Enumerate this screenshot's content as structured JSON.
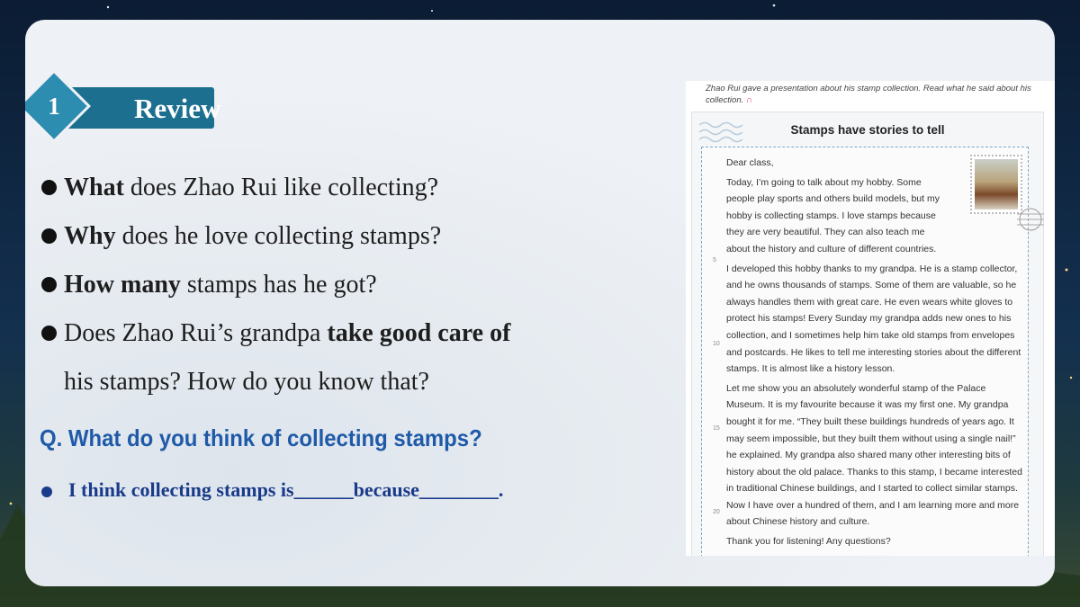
{
  "section": {
    "number": "1",
    "title": "Review"
  },
  "questions": [
    {
      "bold": "What",
      "rest": " does Zhao Rui like collecting?"
    },
    {
      "bold": "Why",
      "rest": " does he love collecting stamps?"
    },
    {
      "bold": "How many",
      "rest": " stamps has he got?"
    },
    {
      "pre": "Does Zhao Rui’s grandpa ",
      "bold": "take good care of",
      "cont": "his stamps? How do you know that?"
    }
  ],
  "discussion": {
    "question": "Q. What do you think of collecting stamps?",
    "prompt": "I think collecting stamps is______because________."
  },
  "textbook": {
    "intro": "Zhao Rui gave a presentation about his stamp collection. Read what he said about his collection.",
    "title": "Stamps have stories to tell",
    "greeting": "Dear class,",
    "paragraphs": [
      "Today, I’m going to talk about my hobby. Some people play sports and others build models, but my hobby is collecting stamps. I love stamps because they are very beautiful. They can also teach me about the history and culture of different countries.",
      "I developed this hobby thanks to my grandpa. He is a stamp collector, and he owns thousands of stamps. Some of them are valuable, so he always handles them with great care. He even wears white gloves to protect his stamps! Every Sunday my grandpa adds new ones to his collection, and I sometimes help him take old stamps from envelopes and postcards. He likes to tell me interesting stories about the different stamps. It is almost like a history lesson.",
      "Let me show you an absolutely wonderful stamp of the Palace Museum. It is my favourite because it was my first one. My grandpa bought it for me. “They built these buildings hundreds of years ago. It may seem impossible, but they built them without using a single nail!” he explained. My grandpa also shared many other interesting bits of history about the old palace. Thanks to this stamp, I became interested in traditional Chinese buildings, and I started to collect similar stamps. Now I have over a hundred of them, and I am learning more and more about Chinese history and culture.",
      "Thank you for listening! Any questions?"
    ],
    "line_numbers": [
      "5",
      "10",
      "15",
      "20"
    ],
    "icons": [
      "headphone-icon",
      "stamp-image",
      "postmark-icon",
      "wave-decoration"
    ]
  },
  "colors": {
    "badge": "#1c6f8e",
    "diamond": "#2d8db0",
    "question": "#1f5aa8",
    "answer": "#1a3a8a"
  }
}
